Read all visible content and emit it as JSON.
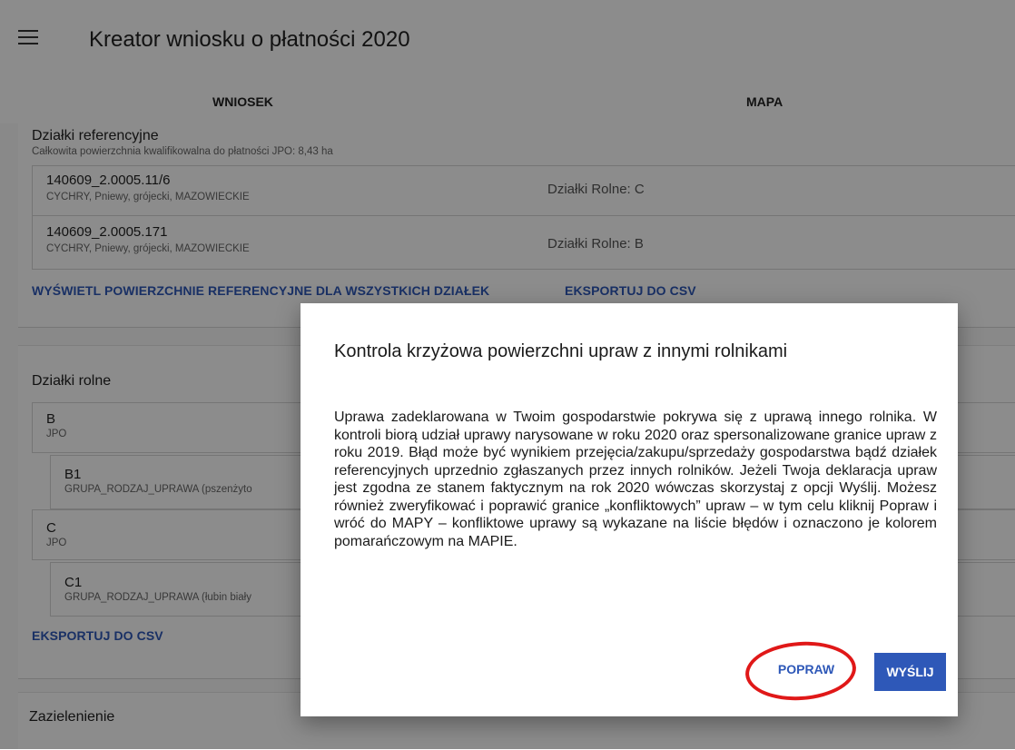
{
  "header": {
    "title": "Kreator wniosku o płatności 2020",
    "menu_icon": "hamburger-icon"
  },
  "tabs": [
    {
      "label": "WNIOSEK"
    },
    {
      "label": "MAPA"
    }
  ],
  "reference_parcels": {
    "title": "Działki referencyjne",
    "subtitle": "Całkowita powierzchnia kwalifikowalna do płatności JPO: 8,43 ha",
    "items": [
      {
        "id": "140609_2.0005.11/6",
        "location": "CYCHRY, Pniewy, grójecki, MAZOWIECKIE",
        "agri": "Działki Rolne: C"
      },
      {
        "id": "140609_2.0005.171",
        "location": "CYCHRY, Pniewy, grójecki, MAZOWIECKIE",
        "agri": "Działki Rolne: B"
      }
    ],
    "links": [
      "WYŚWIETL POWIERZCHNIE REFERENCYJNE DLA WSZYSTKICH DZIAŁEK",
      "EKSPORTUJ DO CSV"
    ]
  },
  "agri_parcels": {
    "title": "Działki rolne",
    "items": [
      {
        "name": "B",
        "type": "JPO"
      },
      {
        "name": "B1",
        "type": "GRUPA_RODZAJ_UPRAWA (pszenżyto"
      },
      {
        "name": "C",
        "type": "JPO"
      },
      {
        "name": "C1",
        "type": "GRUPA_RODZAJ_UPRAWA (łubin biały"
      }
    ],
    "export_link": "EKSPORTUJ DO CSV"
  },
  "greening": {
    "title": "Zazielenienie"
  },
  "dialog": {
    "title": "Kontrola krzyżowa powierzchni upraw z innymi rolnikami",
    "body": "Uprawa zadeklarowana w Twoim gospodarstwie pokrywa się z uprawą innego rolnika. W kontroli biorą udział uprawy narysowane w roku 2020 oraz spersonalizowane granice upraw z roku 2019. Błąd może być wynikiem przejęcia/zakupu/sprzedaży gospodarstwa bądź działek referencyjnych uprzednio zgłaszanych przez innych rolników. Jeżeli Twoja deklaracja upraw jest zgodna ze stanem faktycznym na rok 2020 wówczas skorzystaj z opcji Wyślij. Możesz również zweryfikować i poprawić granice „konfliktowych” upraw – w tym celu kliknij Popraw i wróć do MAPY – konfliktowe uprawy są wykazane na liście błędów i oznaczono je kolorem pomarańczowym na MAPIE.",
    "popraw_label": "POPRAW",
    "wyslij_label": "WYŚLIJ"
  },
  "colors": {
    "accent": "#2e58b8",
    "highlight_ring": "#e01818"
  }
}
